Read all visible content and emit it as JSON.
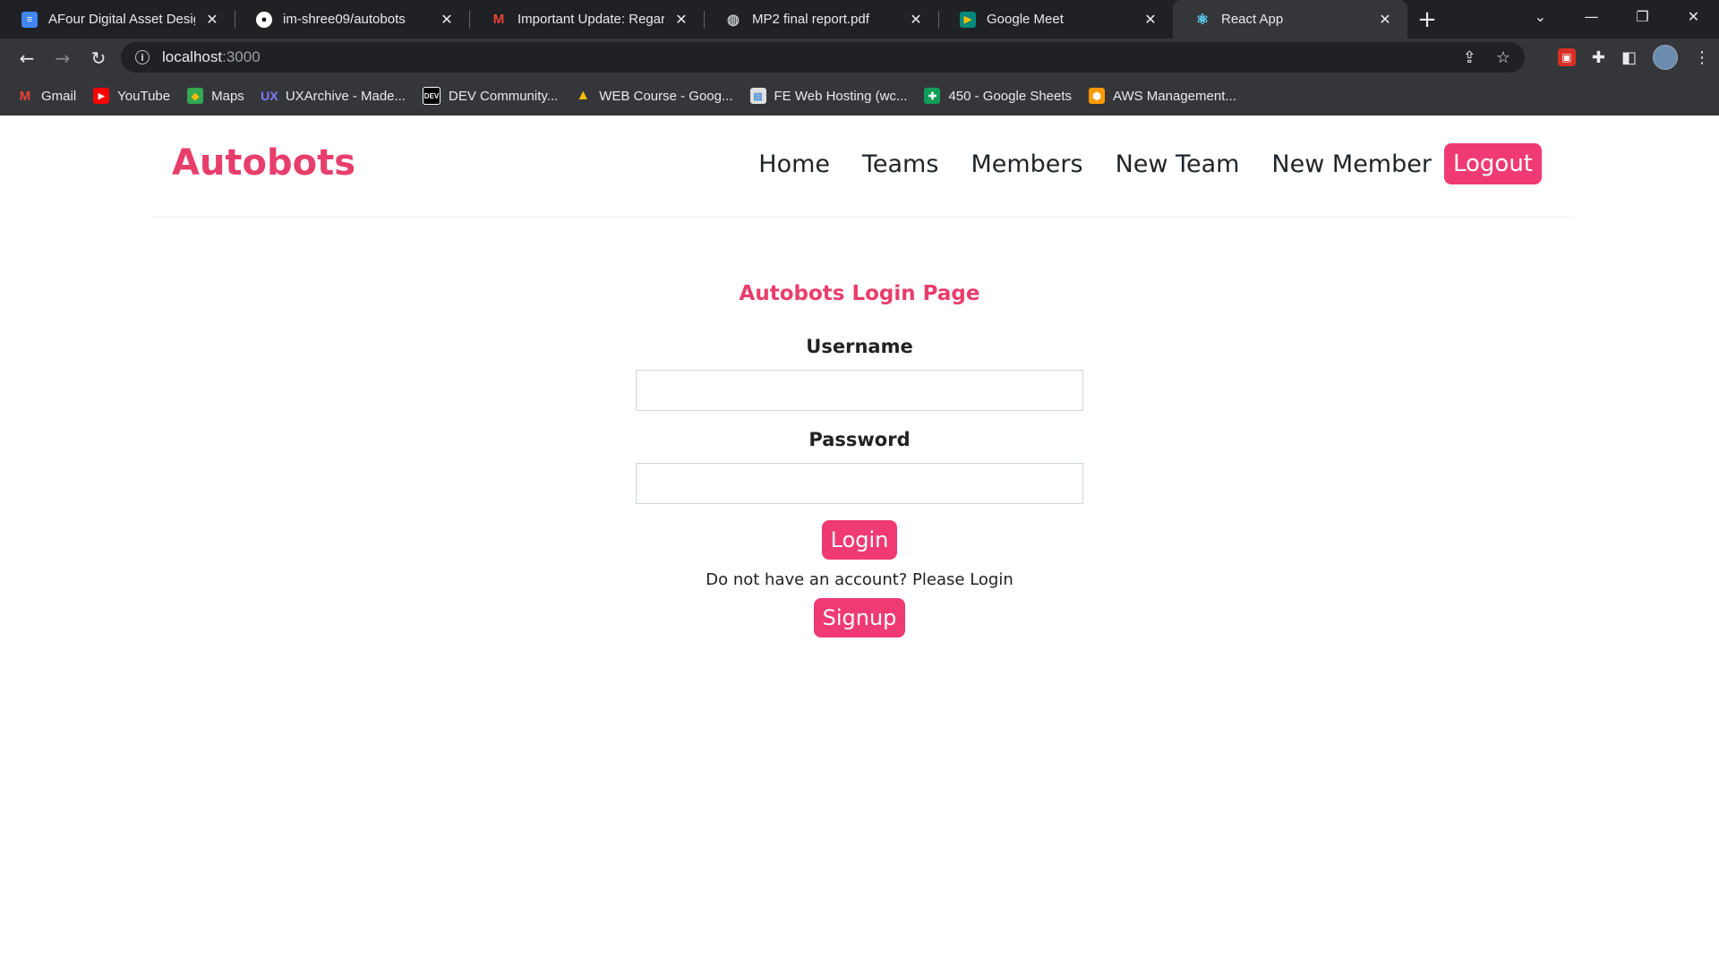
{
  "browser": {
    "tabs": [
      {
        "title": "AFour Digital Asset Design",
        "favicon": "docs-icon",
        "active": false
      },
      {
        "title": "im-shree09/autobots",
        "favicon": "github-icon",
        "active": false
      },
      {
        "title": "Important Update: Regardin",
        "favicon": "gmail-icon",
        "active": false
      },
      {
        "title": "MP2 final report.pdf",
        "favicon": "globe-icon",
        "active": false
      },
      {
        "title": "Google Meet",
        "favicon": "meet-icon",
        "active": false
      },
      {
        "title": "React App",
        "favicon": "react-icon",
        "active": true
      }
    ],
    "url_host": "localhost",
    "url_port": ":3000",
    "bookmarks": [
      {
        "label": "Gmail",
        "icon": "gmail-icon",
        "color": "#ea4335"
      },
      {
        "label": "YouTube",
        "icon": "youtube-icon",
        "color": "#ff0000"
      },
      {
        "label": "Maps",
        "icon": "maps-icon",
        "color": "#34a853"
      },
      {
        "label": "UXArchive - Made...",
        "icon": "ux-icon",
        "color": "#6c63ff"
      },
      {
        "label": "DEV Community...",
        "icon": "dev-icon",
        "color": "#000000"
      },
      {
        "label": "WEB Course - Goog...",
        "icon": "drive-icon",
        "color": "#fbbc04"
      },
      {
        "label": "FE Web Hosting (wc...",
        "icon": "page-icon",
        "color": "#dddddd"
      },
      {
        "label": "450 - Google Sheets",
        "icon": "sheets-icon",
        "color": "#0f9d58"
      },
      {
        "label": "AWS Management...",
        "icon": "aws-icon",
        "color": "#ff9900"
      }
    ]
  },
  "app": {
    "brand": "Autobots",
    "nav": {
      "home": "Home",
      "teams": "Teams",
      "members": "Members",
      "new_team": "New Team",
      "new_member": "New Member",
      "logout": "Logout"
    },
    "login": {
      "title": "Autobots Login Page",
      "username_label": "Username",
      "username_value": "",
      "password_label": "Password",
      "password_value": "",
      "login_button": "Login",
      "helper_text": "Do not have an account? Please Login",
      "signup_button": "Signup"
    },
    "accent_color": "#ef3a74"
  }
}
